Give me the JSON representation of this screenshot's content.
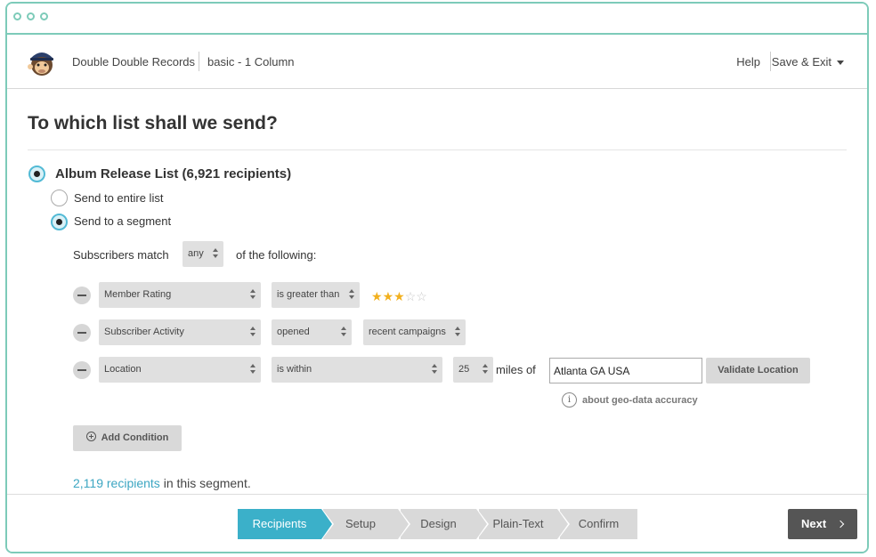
{
  "colors": {
    "accent": "#3bb0c9",
    "window_border": "#7dcbb9",
    "link": "#3ca6c2",
    "star": "#f2b01e"
  },
  "header": {
    "logo_icon": "mailchimp-monkey-icon",
    "campaign_name": "Double Double Records",
    "template_name": "basic - 1 Column",
    "help_label": "Help",
    "save_exit_label": "Save & Exit"
  },
  "main": {
    "title": "To which list shall we send?",
    "list": {
      "label": "Album Release List (6,921 recipients)",
      "selected": true
    },
    "send_options": [
      {
        "label": "Send to entire list",
        "selected": false
      },
      {
        "label": "Send to a segment",
        "selected": true
      }
    ],
    "match": {
      "prefix": "Subscribers match",
      "value": "any",
      "suffix": "of the following:"
    },
    "conditions": [
      {
        "field": "Member Rating",
        "operator": "is greater than",
        "rating": 3,
        "rating_max": 5
      },
      {
        "field": "Subscriber Activity",
        "operator": "opened",
        "value": "recent campaigns"
      },
      {
        "field": "Location",
        "operator": "is within",
        "distance": "25",
        "unit_label": "miles of",
        "location": "Atlanta GA USA",
        "validate_label": "Validate Location"
      }
    ],
    "geo_info_label": "about geo-data accuracy",
    "add_condition_label": "Add Condition",
    "segment_count_link": "2,119 recipients",
    "segment_count_suffix": "in this segment."
  },
  "footer": {
    "steps": [
      {
        "label": "Recipients",
        "active": true
      },
      {
        "label": "Setup",
        "active": false
      },
      {
        "label": "Design",
        "active": false
      },
      {
        "label": "Plain-Text",
        "active": false
      },
      {
        "label": "Confirm",
        "active": false
      }
    ],
    "next_label": "Next"
  }
}
